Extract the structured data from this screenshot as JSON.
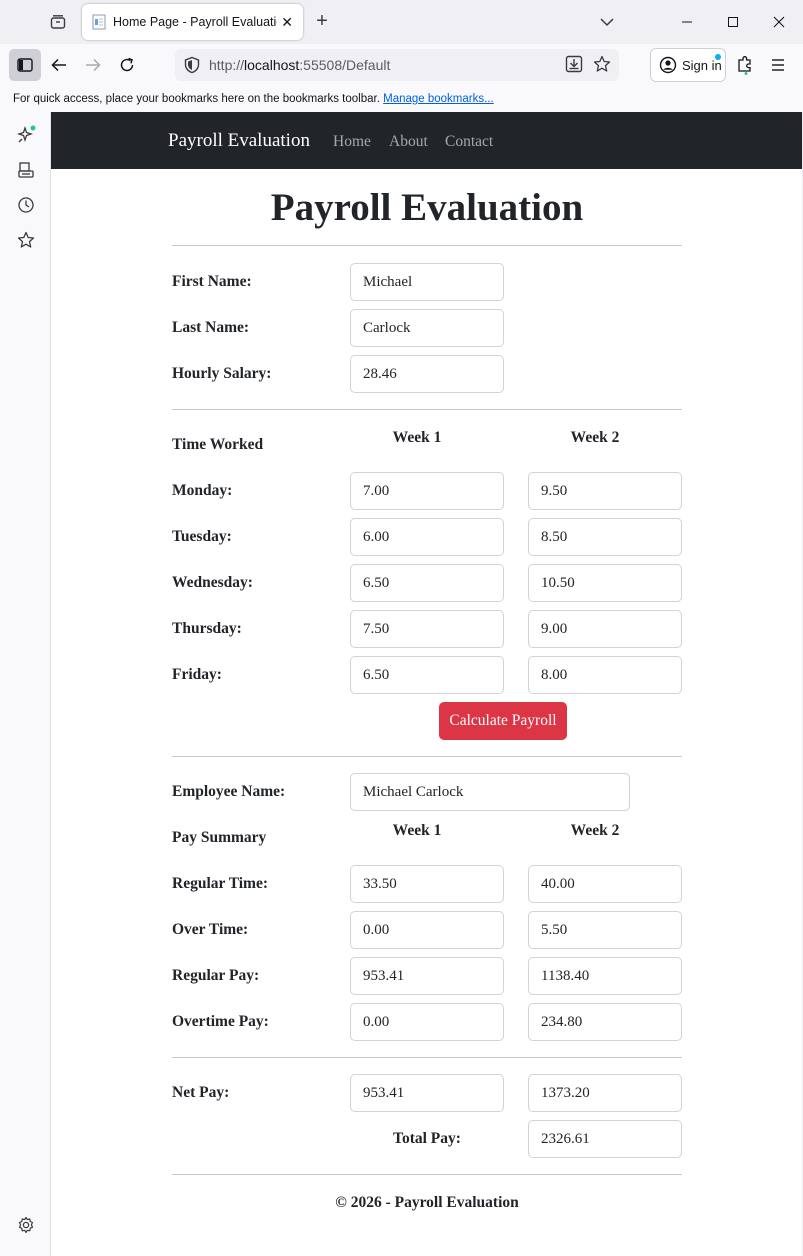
{
  "browser": {
    "tab_title": "Home Page - Payroll Evaluation",
    "url_scheme": "http://",
    "url_host": "localhost",
    "url_rest": ":55508/Default",
    "sign_in": "Sign in",
    "bookmarks_text": "For quick access, place your bookmarks here on the bookmarks toolbar.",
    "bookmarks_link": "Manage bookmarks..."
  },
  "site": {
    "brand": "Payroll Evaluation",
    "nav": [
      "Home",
      "About",
      "Contact"
    ]
  },
  "page": {
    "title": "Payroll Evaluation",
    "employee": {
      "first_name_label": "First Name:",
      "first_name": "Michael",
      "last_name_label": "Last Name:",
      "last_name": "Carlock",
      "hourly_label": "Hourly Salary:",
      "hourly": "28.46"
    },
    "time": {
      "heading": "Time Worked",
      "week1": "Week 1",
      "week2": "Week 2",
      "days": [
        {
          "label": "Monday:",
          "w1": "7.00",
          "w2": "9.50"
        },
        {
          "label": "Tuesday:",
          "w1": "6.00",
          "w2": "8.50"
        },
        {
          "label": "Wednesday:",
          "w1": "6.50",
          "w2": "10.50"
        },
        {
          "label": "Thursday:",
          "w1": "7.50",
          "w2": "9.00"
        },
        {
          "label": "Friday:",
          "w1": "6.50",
          "w2": "8.00"
        }
      ],
      "calculate": "Calculate Payroll"
    },
    "summary": {
      "employee_name_label": "Employee Name:",
      "employee_name": "Michael Carlock",
      "heading": "Pay Summary",
      "week1": "Week 1",
      "week2": "Week 2",
      "rows": [
        {
          "label": "Regular Time:",
          "w1": "33.50",
          "w2": "40.00"
        },
        {
          "label": "Over Time:",
          "w1": "0.00",
          "w2": "5.50"
        },
        {
          "label": "Regular Pay:",
          "w1": "953.41",
          "w2": "1138.40"
        },
        {
          "label": "Overtime Pay:",
          "w1": "0.00",
          "w2": "234.80"
        }
      ]
    },
    "net": {
      "label": "Net Pay:",
      "w1": "953.41",
      "w2": "1373.20",
      "total_label": "Total Pay:",
      "total": "2326.61"
    },
    "footer": "© 2026 - Payroll Evaluation"
  }
}
